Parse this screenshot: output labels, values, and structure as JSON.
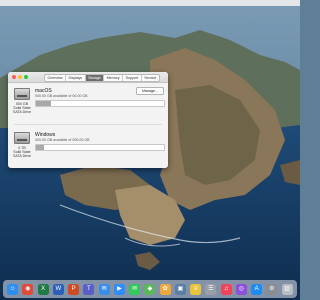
{
  "window": {
    "tabs": [
      {
        "label": "Overview",
        "active": false
      },
      {
        "label": "Displays",
        "active": false
      },
      {
        "label": "Storage",
        "active": true
      },
      {
        "label": "Memory",
        "active": false
      },
      {
        "label": "Support",
        "active": false
      },
      {
        "label": "Service",
        "active": false
      }
    ],
    "manage_label": "Manage...",
    "disks": [
      {
        "name": "macOS",
        "available": "000.00 GB available of 00.00 GB",
        "capacity": "000 GB",
        "type_line1": "Solid State",
        "type_line2": "SATA Drive",
        "used_fraction": 0.12
      },
      {
        "name": "Windows",
        "available": "000.00 GB available of 000.00 GB",
        "capacity": "0 TB",
        "type_line1": "Solid State",
        "type_line2": "SATA Drive",
        "used_fraction": 0.06
      }
    ]
  },
  "dock": {
    "apps": [
      {
        "name": "Finder",
        "glyph": "☺",
        "color": "#2c8ff0"
      },
      {
        "name": "Chrome",
        "glyph": "◉",
        "color": "#e04a3a"
      },
      {
        "name": "Excel",
        "glyph": "X",
        "color": "#1f7a45"
      },
      {
        "name": "Word",
        "glyph": "W",
        "color": "#2b5fb8"
      },
      {
        "name": "PowerPoint",
        "glyph": "P",
        "color": "#d04a22"
      },
      {
        "name": "Teams",
        "glyph": "T",
        "color": "#5a5fc6"
      },
      {
        "name": "Mail",
        "glyph": "✉",
        "color": "#3a8ee8"
      },
      {
        "name": "Zoom",
        "glyph": "▶",
        "color": "#2d8cff"
      },
      {
        "name": "Messages",
        "glyph": "✉",
        "color": "#34c759"
      },
      {
        "name": "Maps",
        "glyph": "◆",
        "color": "#5bb85c"
      },
      {
        "name": "Photos",
        "glyph": "✿",
        "color": "#f2a93b"
      },
      {
        "name": "Preview",
        "glyph": "▣",
        "color": "#5b7fa6"
      },
      {
        "name": "Notes",
        "glyph": "≡",
        "color": "#e8c53a"
      },
      {
        "name": "Reminders",
        "glyph": "☰",
        "color": "#9aa0a8"
      },
      {
        "name": "Music",
        "glyph": "♫",
        "color": "#f0445a"
      },
      {
        "name": "Podcasts",
        "glyph": "◎",
        "color": "#8e4fd9"
      },
      {
        "name": "App Store",
        "glyph": "A",
        "color": "#1d8cf0"
      },
      {
        "name": "System Preferences",
        "glyph": "⚙",
        "color": "#8a8d92"
      },
      {
        "name": "Trash",
        "glyph": "▥",
        "color": "#b9bcc2"
      }
    ]
  }
}
